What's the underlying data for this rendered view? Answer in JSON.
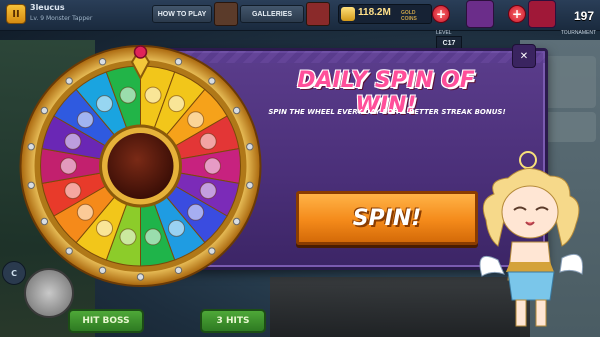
{
  "topbar": {
    "pause_label": "II",
    "player_name": "3leucus",
    "player_rank": "Lv. 9 Monster Tapper",
    "how_to_play_label": "HOW TO PLAY",
    "galleries_label": "GALLERIES",
    "gold_value": "118.2M",
    "gold_label": "GOLD COINS",
    "gem_count": "197",
    "level_caption": "LEVEL",
    "level_value": "C17",
    "tournament_caption": "TOURNAMENT"
  },
  "modal": {
    "title": "DAILY SPIN OF WIN!",
    "subtitle": "SPIN THE WHEEL EVERY DAY FOR A BETTER STREAK BONUS!",
    "spin_button": "SPIN!",
    "close_symbol": "✕"
  },
  "wheel": {
    "segment_colors": [
      "#f2c61a",
      "#f2c61a",
      "#f6a21a",
      "#e33636",
      "#c7227f",
      "#7b2bb8",
      "#3a4ce0",
      "#1f9ce2",
      "#1fb44a",
      "#8ccc2a",
      "#f2c61a",
      "#f58a1a",
      "#e83a2a",
      "#c2206e",
      "#6a27b5",
      "#2f5ae0",
      "#1aa4e0",
      "#22b448"
    ],
    "segment_icons": [
      "leaf-icon",
      "gold-bag-icon",
      "crown-icon",
      "ring-icon",
      "wing-icon",
      "potion-icon",
      "sword-icon",
      "gold-pile-icon",
      "mask-icon",
      "gem-cluster-icon",
      "drop-icon",
      "shell-icon",
      "necklace-icon",
      "chest-icon",
      "feather-icon",
      "boots-icon",
      "coin-icon",
      "angel-icon"
    ]
  },
  "background": {
    "bottom_button_1": "HIT BOSS",
    "bottom_button_2": "3 HITS",
    "level_badge": "C"
  }
}
